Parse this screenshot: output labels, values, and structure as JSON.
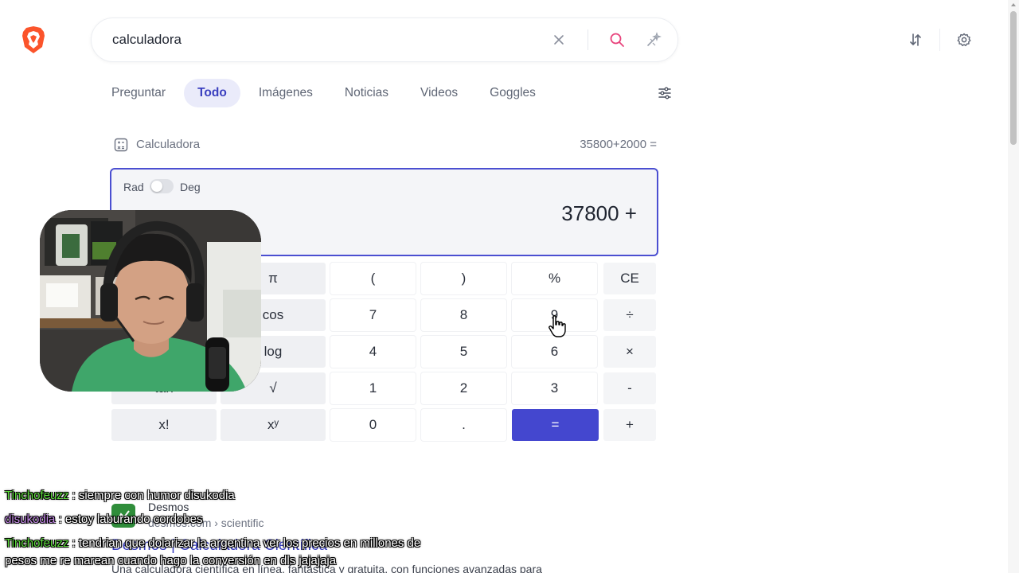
{
  "search": {
    "query": "calculadora"
  },
  "tabs": [
    {
      "label": "Preguntar",
      "active": false
    },
    {
      "label": "Todo",
      "active": true
    },
    {
      "label": "Imágenes",
      "active": false
    },
    {
      "label": "Noticias",
      "active": false
    },
    {
      "label": "Videos",
      "active": false
    },
    {
      "label": "Goggles",
      "active": false
    }
  ],
  "calculator": {
    "header_label": "Calculadora",
    "expression": "35800+2000 =",
    "rad_label": "Rad",
    "deg_label": "Deg",
    "display_value": "37800 +",
    "keys": {
      "row1": [
        "π",
        "(",
        ")",
        "%",
        "CE"
      ],
      "row2": [
        "cos",
        "7",
        "8",
        "9",
        "÷"
      ],
      "row3": [
        "log",
        "4",
        "5",
        "6",
        "×"
      ],
      "row4": [
        "tan",
        "√",
        "1",
        "2",
        "3",
        "-"
      ],
      "row5": [
        "x!",
        "xʸ",
        "0",
        ".",
        "=",
        "+"
      ]
    }
  },
  "result": {
    "site_name": "Desmos",
    "url": "desmos.com › scientific",
    "title": "Desmos | Calculadora Científica",
    "snippet": "Una calculadora científica en línea, fantástica y gratuita, con funciones avanzadas para"
  },
  "chat": [
    {
      "user": "Tinchofeuzz",
      "user_color": "#5ddc3c",
      "message": ": siempre con humor disukodia"
    },
    {
      "user": "disukodia",
      "user_color": "#c58be8",
      "message": ": estoy laburando cordobes"
    },
    {
      "user": "Tinchofeuzz",
      "user_color": "#5ddc3c",
      "message": ": tendrian que dolarizar la argentina ver los precios en millones de"
    },
    {
      "user": "",
      "user_color": "#5ddc3c",
      "message": "pesos me re marean cuando hago la conversión en dls jajajaja"
    }
  ],
  "colors": {
    "accent": "#4447cf",
    "brand": "#fb542b"
  },
  "icons": [
    "brave-lion-logo",
    "clear-icon",
    "search-icon",
    "ai-sparkle-icon",
    "sort-icon",
    "gear-icon",
    "filter-icon",
    "calculator-icon",
    "pointer-cursor"
  ]
}
